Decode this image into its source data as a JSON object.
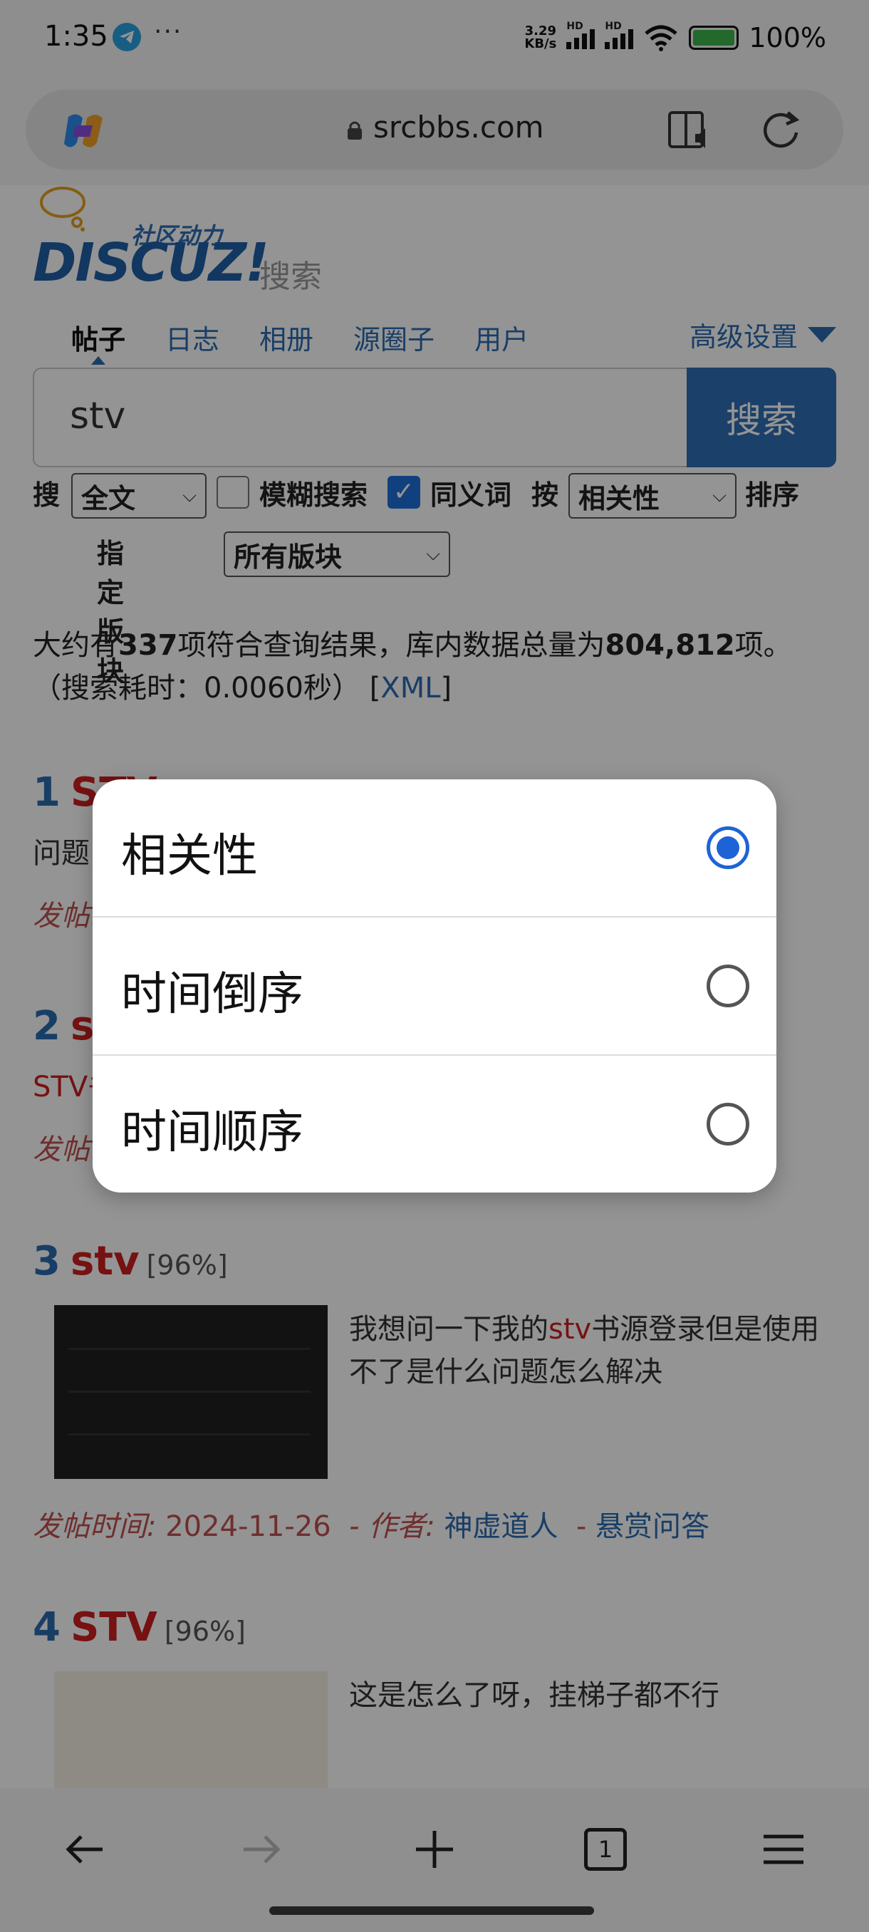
{
  "status_bar": {
    "time": "1:35",
    "more": "···",
    "net_speed_value": "3.29",
    "net_speed_unit": "KB/s",
    "sim1_label": "HD",
    "sim2_label": "HD",
    "battery": "100%"
  },
  "browser": {
    "url": "srcbbs.com"
  },
  "logo": {
    "tagline": "社区动力",
    "brand": "DISCUZ!",
    "section": "搜索"
  },
  "tabs": [
    {
      "label": "帖子"
    },
    {
      "label": "日志"
    },
    {
      "label": "相册"
    },
    {
      "label": "源圈子"
    },
    {
      "label": "用户"
    }
  ],
  "advanced_label": "高级设置",
  "search": {
    "query": "stv",
    "button": "搜索"
  },
  "options": {
    "search_label": "搜",
    "scope_value": "全文",
    "fuzzy_label": "模糊搜索",
    "fuzzy_checked": false,
    "synonym_label": "同义词",
    "synonym_checked": true,
    "by_label": "按",
    "order_value": "相关性",
    "order_suffix": "排序",
    "board_label": "指定版块",
    "board_value": "所有版块"
  },
  "stats": {
    "prefix": "大约有",
    "count": "337",
    "middle": "项符合查询结果，库内数据总量为",
    "total": "804,812",
    "suffix": "项。",
    "time_text": "（搜索耗时：0.0060秒）",
    "xml_open": "[",
    "xml_link": "XML",
    "xml_close": "]"
  },
  "results": [
    {
      "num": "1",
      "title": "STV",
      "snippet": "问题",
      "meta_label": "发帖时"
    },
    {
      "num": "2",
      "title": "stv",
      "snippet": "STV书",
      "meta_label": "发帖时"
    },
    {
      "num": "3",
      "title": "stv",
      "pct": "[96%]",
      "snippet_pre": "我想问一下我的",
      "snippet_hl": "stv",
      "snippet_post": "书源登录但是使用不了是什么问题怎么解决",
      "date_label": "发帖时间:",
      "date": "2024-11-26",
      "author_label": "- 作者:",
      "author": "神虚道人",
      "forum_sep": "-",
      "forum": "悬赏问答"
    },
    {
      "num": "4",
      "title": "STV",
      "pct": "[96%]",
      "snippet": "这是怎么了呀，挂梯子都不行"
    }
  ],
  "dialog": {
    "options": [
      {
        "label": "相关性",
        "selected": true
      },
      {
        "label": "时间倒序",
        "selected": false
      },
      {
        "label": "时间顺序",
        "selected": false
      }
    ]
  },
  "bottom_bar": {
    "tab_count": "1"
  }
}
